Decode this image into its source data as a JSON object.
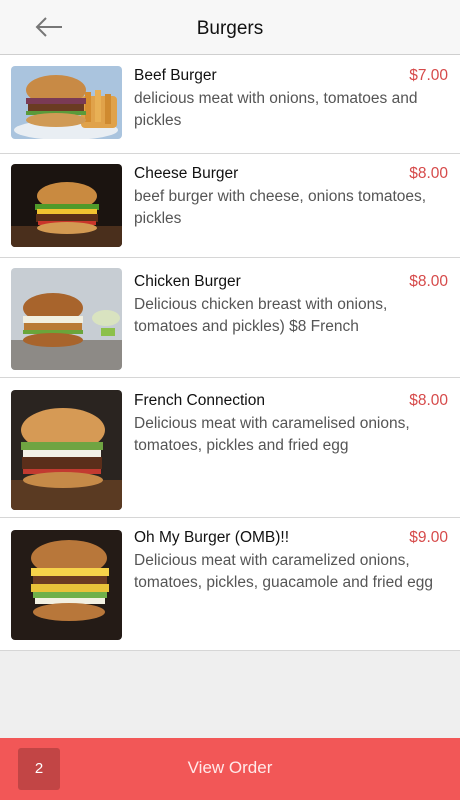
{
  "header": {
    "title": "Burgers",
    "back_icon": "arrow-left-icon"
  },
  "items": [
    {
      "name": "Beef Burger",
      "price": "$7.00",
      "description": "delicious meat with onions, tomatoes and pickles"
    },
    {
      "name": "Cheese Burger",
      "price": "$8.00",
      "description": "beef burger with cheese, onions tomatoes, pickles"
    },
    {
      "name": "Chicken Burger",
      "price": "$8.00",
      "description": "Delicious chicken breast with onions, tomatoes and pickles) $8 French"
    },
    {
      "name": "French Connection",
      "price": "$8.00",
      "description": "Delicious meat with caramelised onions, tomatoes, pickles and fried egg"
    },
    {
      "name": "Oh My Burger (OMB)!!",
      "price": "$9.00",
      "description": "Delicious meat with caramelized onions, tomatoes, pickles, guacamole and fried egg"
    }
  ],
  "footer": {
    "cart_count": "2",
    "view_order_label": "View Order"
  },
  "colors": {
    "accent": "#f25757",
    "price": "#d64a4a",
    "badge": "#c24545"
  }
}
